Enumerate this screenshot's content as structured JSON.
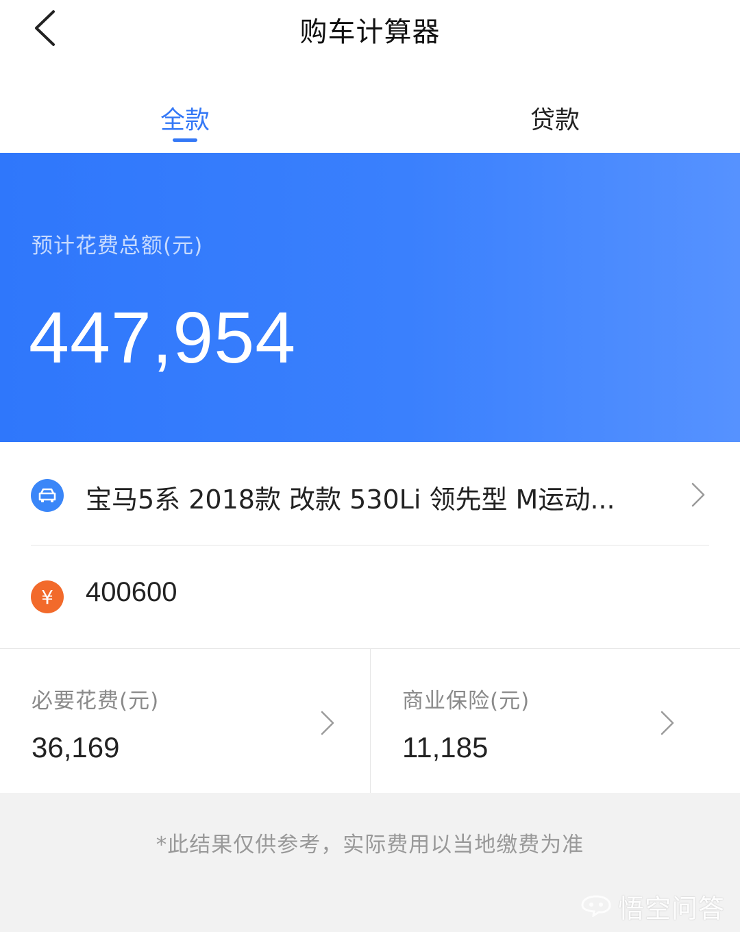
{
  "navbar": {
    "title": "购车计算器",
    "back_icon": "chevron-left-icon"
  },
  "tabs": [
    {
      "label": "全款",
      "active": true
    },
    {
      "label": "贷款",
      "active": false
    }
  ],
  "summary": {
    "label": "预计花费总额(元)",
    "total": "447,954",
    "gradient_colors": [
      "#2f77fb",
      "#5692ff"
    ]
  },
  "car": {
    "name": "宝马5系 2018款 改款 530Li 领先型 M运动...",
    "icon": "car-icon",
    "icon_color": "#3a86f8"
  },
  "price": {
    "value": "400600",
    "icon": "yen-icon",
    "icon_symbol": "¥",
    "icon_color": "#f26a2b"
  },
  "costs": [
    {
      "label": "必要花费(元)",
      "value": "36,169"
    },
    {
      "label": "商业保险(元)",
      "value": "11,185"
    }
  ],
  "footer": {
    "disclaimer": "*此结果仅供参考，实际费用以当地缴费为准"
  },
  "watermark": {
    "text": "悟空问答",
    "icon": "wukong-logo-icon"
  },
  "colors": {
    "accent": "#3478f6",
    "text_primary": "#222222",
    "text_secondary": "#8a8a8a",
    "footer_bg": "#f2f2f2"
  }
}
